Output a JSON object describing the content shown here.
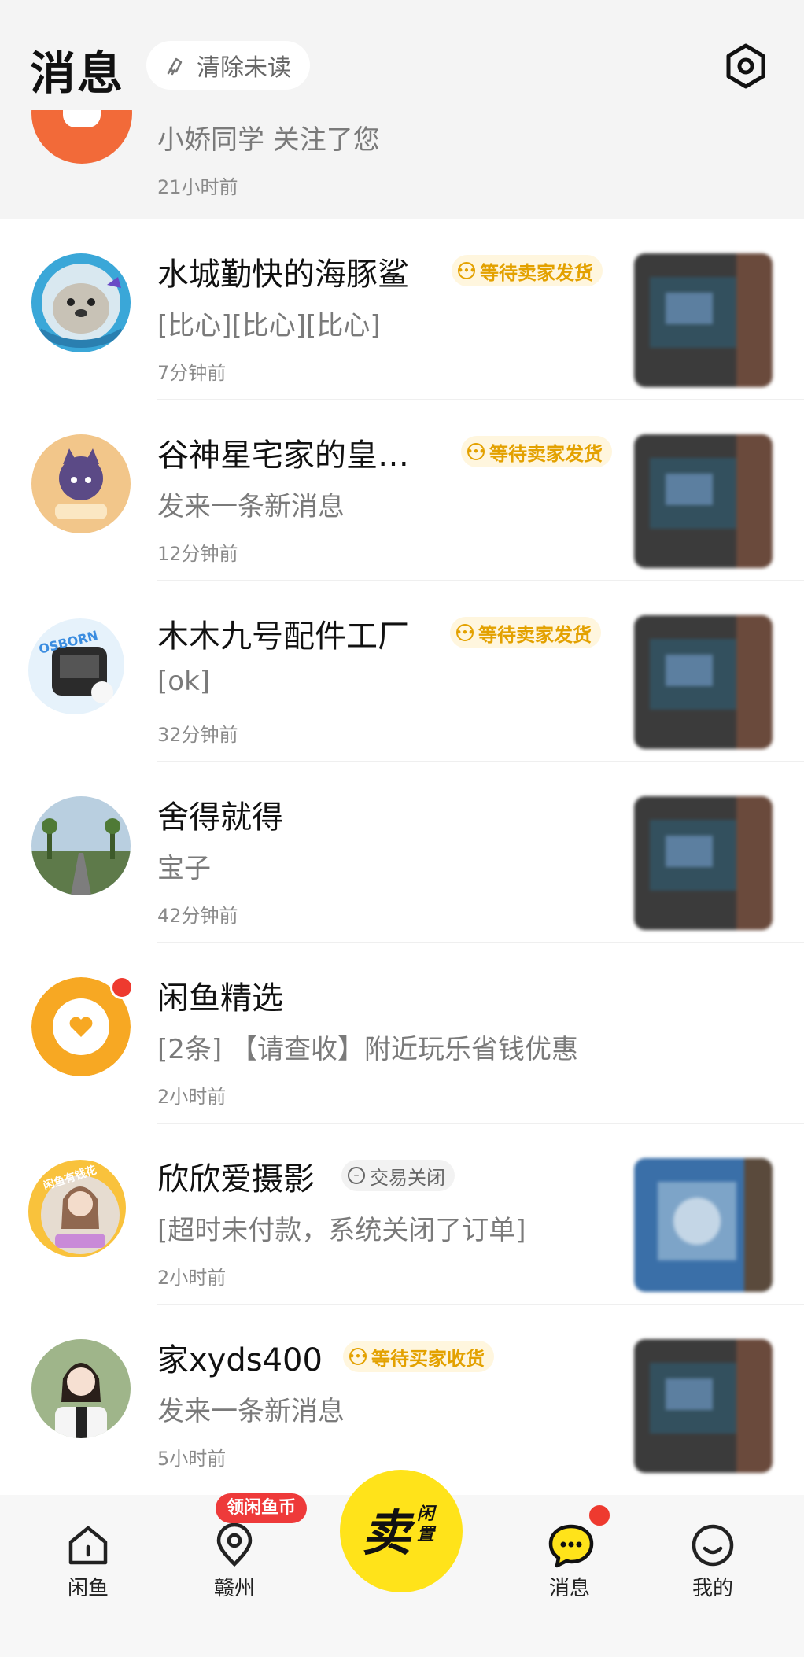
{
  "header": {
    "title": "消息",
    "clear_unread": "清除未读"
  },
  "follow_notice": {
    "text": "小娇同学 关注了您",
    "time": "21小时前"
  },
  "messages": [
    {
      "name": "水城勤快的海豚鲨",
      "badge": "等待卖家发货",
      "preview": "[比心][比心][比心]",
      "time": "7分钟前"
    },
    {
      "name": "谷神星宅家的皇…",
      "badge": "等待卖家发货",
      "preview": "发来一条新消息",
      "time": "12分钟前"
    },
    {
      "name": "木木九号配件工厂",
      "badge": "等待卖家发货",
      "preview": "[ok]",
      "time": "32分钟前"
    },
    {
      "name": "舍得就得",
      "badge": "",
      "preview": "宝子",
      "time": "42分钟前"
    },
    {
      "name": "闲鱼精选",
      "badge": "",
      "preview": "[2条] 【请查收】附近玩乐省钱优惠",
      "time": "2小时前"
    },
    {
      "name": "欣欣爱摄影",
      "badge": "交易关闭",
      "preview": "[超时未付款，系统关闭了订单]",
      "time": "2小时前"
    },
    {
      "name": "家xyds400",
      "badge": "等待买家收货",
      "preview": "发来一条新消息",
      "time": "5小时前"
    }
  ],
  "avatar_text": {
    "osborn": "OSBORN",
    "xianyu_badge": "闲鱼有钱花"
  },
  "tabbar": {
    "home": "闲鱼",
    "city": "赣州",
    "coin_pill": "领闲鱼币",
    "sell_big": "卖",
    "sell_small": "闲置",
    "messages": "消息",
    "mine": "我的"
  },
  "colors": {
    "accent_yellow": "#ffe31a",
    "badge_text": "#e3a100",
    "red_dot": "#ee3a2f"
  }
}
